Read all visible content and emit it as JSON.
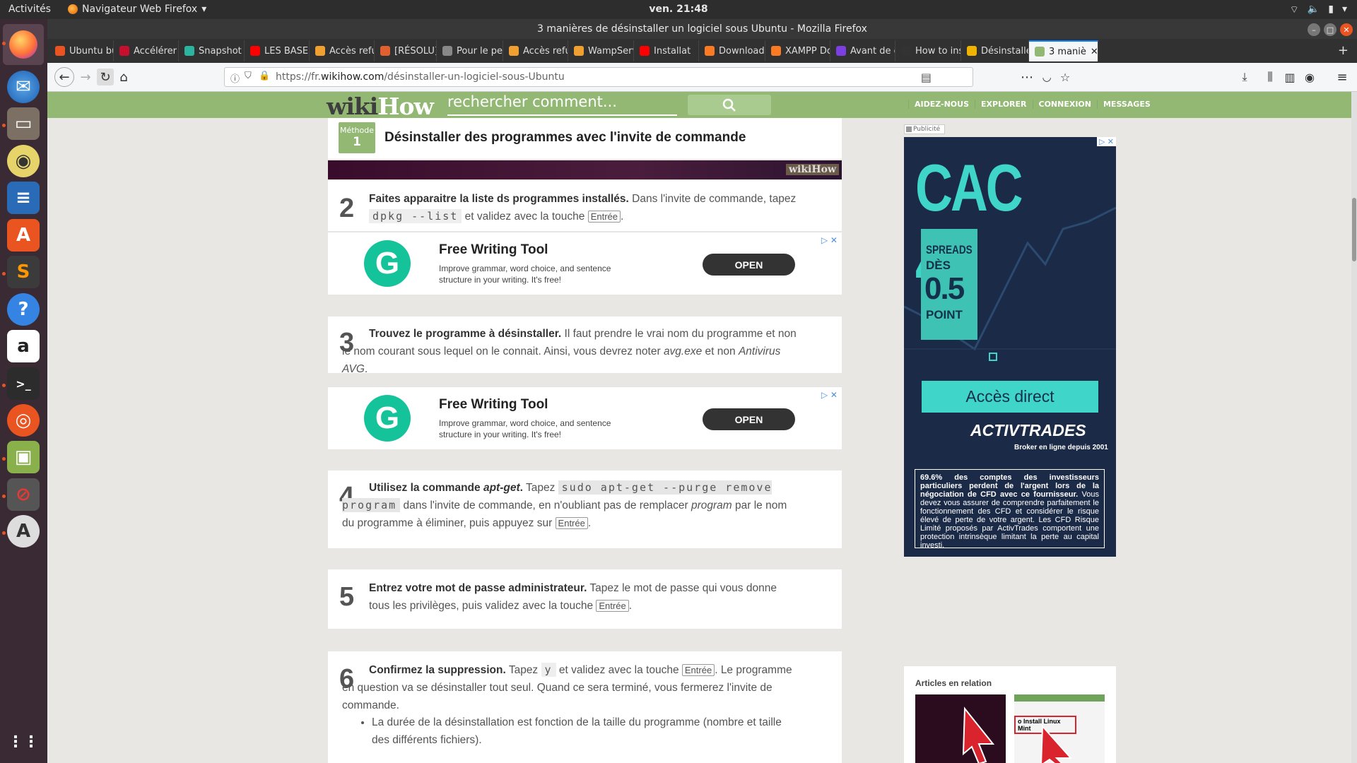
{
  "topbar": {
    "activities": "Activités",
    "app_name": "Navigateur Web Firefox",
    "clock": "ven. 21:48"
  },
  "window": {
    "title": "3 manières de désinstaller un logiciel sous Ubuntu - Mozilla Firefox"
  },
  "tabs": [
    {
      "label": "Ubuntu bu",
      "color": "#e95420"
    },
    {
      "label": "Accélérer",
      "color": "#c8102e"
    },
    {
      "label": "Snapshot",
      "color": "#2bb5a0"
    },
    {
      "label": "LES BASES",
      "color": "#ff0000"
    },
    {
      "label": "Accès refu",
      "color": "#f0a030"
    },
    {
      "label": "[RÉSOLU]",
      "color": "#e06030"
    },
    {
      "label": "Pour le peuple",
      "color": "#888888"
    },
    {
      "label": "Accès refu",
      "color": "#f0a030"
    },
    {
      "label": "WampServ",
      "color": "#f0a030"
    },
    {
      "label": "Installat",
      "color": "#ff0000"
    },
    {
      "label": "Download",
      "color": "#fb7a24"
    },
    {
      "label": "XAMPP Do",
      "color": "#fb7a24"
    },
    {
      "label": "Avant de c",
      "color": "#7b3fe4"
    },
    {
      "label": "How to ins",
      "color": "#333333"
    },
    {
      "label": "Désinstalle",
      "color": "#f0b400"
    },
    {
      "label": "3 maniè",
      "color": "#93b874"
    }
  ],
  "url": {
    "prefix": "https://fr.",
    "domain": "wikihow.com",
    "path": "/désinstaller-un-logiciel-sous-Ubuntu"
  },
  "wikihow": {
    "logo_wiki": "wiki",
    "logo_how": "How",
    "search_placeholder": "rechercher comment...",
    "nav": [
      "AIDEZ-NOUS",
      "EXPLORER",
      "CONNEXION",
      "MESSAGES"
    ]
  },
  "method": {
    "label": "Méthode",
    "number": "1",
    "title": "Désinstaller des programmes avec l'invite de commande",
    "image_watermark": "wikiHow"
  },
  "steps": [
    {
      "num": "2",
      "bold": "Faites apparaitre la liste ds programmes installés.",
      "text1": " Dans l'invite de commande, tapez ",
      "code": "dpkg --list",
      "text2": " et validez avec la touche ",
      "key": "Entrée",
      "text3": "."
    },
    {
      "num": "3",
      "bold": "Trouvez le programme à désinstaller.",
      "text1": " Il faut prendre le vrai nom du programme et non le nom courant sous lequel on le connait. Ainsi, vous devrez noter ",
      "em1": "avg.exe",
      "text2": " et non ",
      "em2": "Antivirus AVG",
      "text3": "."
    },
    {
      "num": "4",
      "bold": "Utilisez la commande ",
      "bold_em": "apt-get",
      "bold_end": ".",
      "text1": " Tapez ",
      "code": "sudo apt-get --purge remove program",
      "text2": " dans l'invite de commande, en n'oubliant pas de remplacer ",
      "em1": "program",
      "text3": " par le nom du programme à éliminer, puis appuyez sur ",
      "key": "Entrée",
      "text4": "."
    },
    {
      "num": "5",
      "bold": "Entrez votre mot de passe administrateur.",
      "text1": " Tapez le mot de passe qui vous donne tous les privilèges, puis validez avec la touche ",
      "key": "Entrée",
      "text2": "."
    },
    {
      "num": "6",
      "bold": "Confirmez la suppression.",
      "text1": " Tapez ",
      "code": "y",
      "text2": " et validez avec la touche ",
      "key": "Entrée",
      "text3": ". Le programme en question va se désinstaller tout seul. Quand ce sera terminé, vous fermerez l'invite de commande.",
      "bullet": "La durée de la désinstallation est fonction de la taille du programme (nombre et taille des différents fichiers)."
    }
  ],
  "ads": [
    {
      "title": "Free Writing Tool",
      "desc": "Improve grammar, word choice, and sentence structure in your writing. It's free!",
      "button": "OPEN",
      "logo": "G"
    },
    {
      "title": "Free Writing Tool",
      "desc": "Improve grammar, word choice, and sentence structure in your writing. It's free!",
      "button": "OPEN",
      "logo": "G"
    }
  ],
  "sidebar_ad": {
    "label": "Publicité",
    "headline": "CAC 40",
    "spread_line1": "SPREADS",
    "spread_line2": "DÈS",
    "spread_value": "0.5",
    "spread_unit": "POINT",
    "cta": "Accès direct",
    "brand": "ACTIVTRADES",
    "brand_sub": "Broker en ligne depuis 2001",
    "disclaimer_bold": "69.6% des comptes des investisseurs particuliers perdent de l'argent lors de la négociation de CFD avec ce fournisseur.",
    "disclaimer": " Vous devez vous assurer de comprendre parfaitement le fonctionnement des CFD et considérer le risque élevé de perte de votre argent. Les CFD Risque Limité proposés par ActivTrades comportent une protection intrinsèque limitant la perte au capital investi."
  },
  "related": {
    "title": "Articles en relation",
    "thumb2_label": "o Install Linux Mint"
  }
}
